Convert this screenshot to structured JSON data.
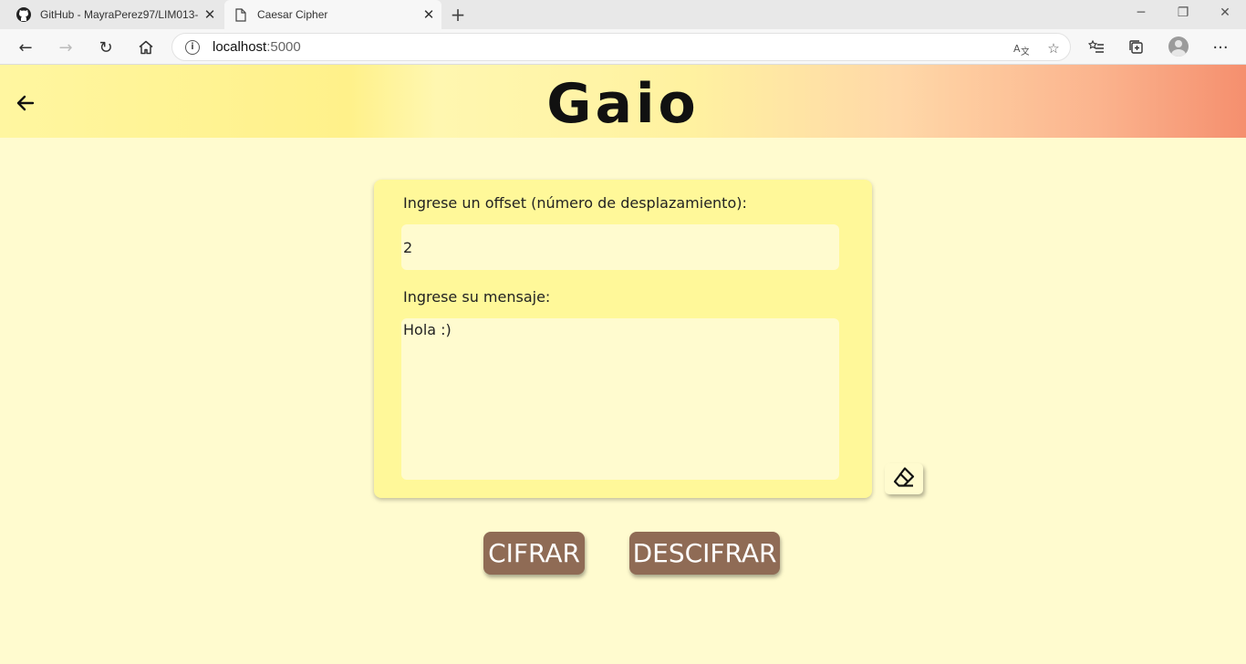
{
  "browser": {
    "tabs": [
      {
        "title": "GitHub - MayraPerez97/LIM013-",
        "icon": "github-icon"
      },
      {
        "title": "Caesar Cipher",
        "icon": "page-icon"
      }
    ],
    "address": {
      "host": "localhost",
      "port": ":5000"
    }
  },
  "page": {
    "logo": "Gaio",
    "offset_label": "Ingrese un offset (número de desplazamiento):",
    "offset_value": "2",
    "message_label": "Ingrese su mensaje:",
    "message_value": "Hola :)",
    "cipher_button": "CIFRAR",
    "decipher_button": "DESCIFRAR"
  },
  "colors": {
    "page_bg": "#fffbcf",
    "card_bg": "#fff899",
    "button_bg": "#8f6b55"
  }
}
